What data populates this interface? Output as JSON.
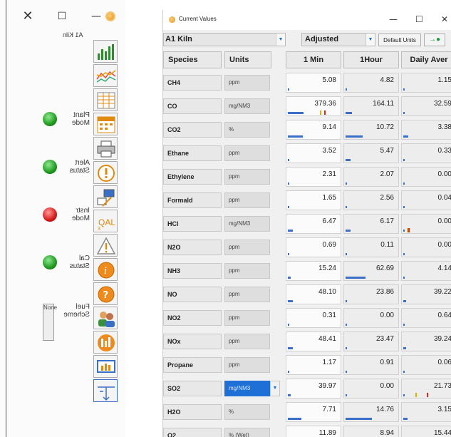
{
  "left_panel": {
    "window_controls": {
      "close": "✕",
      "maximize": "☐",
      "minimize": "—"
    },
    "kiln_label": "A1 Kiln",
    "statuses": [
      {
        "label": "Plant Mode",
        "color": "#1e9a1e"
      },
      {
        "label": "Alert Status",
        "color": "#1e9a1e"
      },
      {
        "label": "Instr Mode",
        "color": "#d81a1a"
      },
      {
        "label": "Cal Status",
        "color": "#1e9a1e"
      }
    ],
    "fuel_label": "Fuel Scheme",
    "fuel_value": "None",
    "tools": [
      "bar-chart-icon",
      "line-chart-icon",
      "table-icon",
      "events-calendar-icon",
      "printer-icon",
      "alert-icon",
      "computer-user-icon",
      "qal-icon",
      "warning-triangle-icon",
      "info-icon",
      "help-icon",
      "users-icon",
      "factory-icon",
      "dashboard-icon",
      "exit-icon"
    ]
  },
  "current_values": {
    "title": "Current Values",
    "window_controls": {
      "minimize": "—",
      "maximize": "☐",
      "close": "✕"
    },
    "kiln_select": "A1 Kiln",
    "mode_select": "Adjusted",
    "default_units_label": "Default Units",
    "connect_label": "→●",
    "headers": {
      "species": "Species",
      "units": "Units",
      "min1": "1 Min",
      "hour1": "1Hour",
      "daily": "Daily Aver"
    },
    "rows": [
      {
        "species": "CH4",
        "unit": "ppm",
        "min1": "5.08",
        "hour1": "4.82",
        "daily": "1.15",
        "b1": 0.02,
        "b2": 0.02,
        "b3": 0
      },
      {
        "species": "CO",
        "unit": "mg/NM3",
        "min1": "379.36",
        "hour1": "164.11",
        "daily": "32.59",
        "b1": 0.3,
        "b2": 0.12,
        "b3": 0
      },
      {
        "species": "CO2",
        "unit": "%",
        "min1": "9.14",
        "hour1": "10.72",
        "daily": "3.38",
        "b1": 0.28,
        "b2": 0.32,
        "b3": 0.1
      },
      {
        "species": "Ethane",
        "unit": "ppm",
        "min1": "3.52",
        "hour1": "5.47",
        "daily": "0.33",
        "b1": 0.02,
        "b2": 0.1,
        "b3": 0
      },
      {
        "species": "Ethylene",
        "unit": "ppm",
        "min1": "2.31",
        "hour1": "2.07",
        "daily": "0.00",
        "b1": 0.02,
        "b2": 0.02,
        "b3": 0
      },
      {
        "species": "Formald",
        "unit": "ppm",
        "min1": "1.65",
        "hour1": "2.56",
        "daily": "0.04",
        "b1": 0.02,
        "b2": 0.02,
        "b3": 0
      },
      {
        "species": "HCl",
        "unit": "mg/NM3",
        "min1": "6.47",
        "hour1": "6.17",
        "daily": "0.00",
        "b1": 0.1,
        "b2": 0.1,
        "b3": 0
      },
      {
        "species": "N2O",
        "unit": "ppm",
        "min1": "0.69",
        "hour1": "0.11",
        "daily": "0.00",
        "b1": 0.02,
        "b2": 0,
        "b3": 0
      },
      {
        "species": "NH3",
        "unit": "ppm",
        "min1": "15.24",
        "hour1": "62.69",
        "daily": "4.14",
        "b1": 0.05,
        "b2": 0.38,
        "b3": 0.02
      },
      {
        "species": "NO",
        "unit": "ppm",
        "min1": "48.10",
        "hour1": "23.86",
        "daily": "39.22",
        "b1": 0.1,
        "b2": 0.02,
        "b3": 0.05
      },
      {
        "species": "NO2",
        "unit": "ppm",
        "min1": "0.31",
        "hour1": "0.00",
        "daily": "0.64",
        "b1": 0,
        "b2": 0,
        "b3": 0.02
      },
      {
        "species": "NOx",
        "unit": "ppm",
        "min1": "48.41",
        "hour1": "23.47",
        "daily": "39.24",
        "b1": 0.1,
        "b2": 0.02,
        "b3": 0.05
      },
      {
        "species": "Propane",
        "unit": "ppm",
        "min1": "1.17",
        "hour1": "0.91",
        "daily": "0.06",
        "b1": 0.02,
        "b2": 0.02,
        "b3": 0
      },
      {
        "species": "SO2",
        "unit": "mg/NM3",
        "min1": "39.97",
        "hour1": "0.00",
        "daily": "21.73",
        "b1": 0.05,
        "b2": 0,
        "b3": 0.02
      },
      {
        "species": "H2O",
        "unit": "%",
        "min1": "7.71",
        "hour1": "14.76",
        "daily": "3.15",
        "b1": 0.25,
        "b2": 0.5,
        "b3": 0.08
      },
      {
        "species": "O2",
        "unit": "% (Wet)",
        "min1": "11.89",
        "hour1": "8.94",
        "daily": "15.44",
        "b1": 0.3,
        "b2": 0.25,
        "b3": 0.3
      }
    ]
  }
}
